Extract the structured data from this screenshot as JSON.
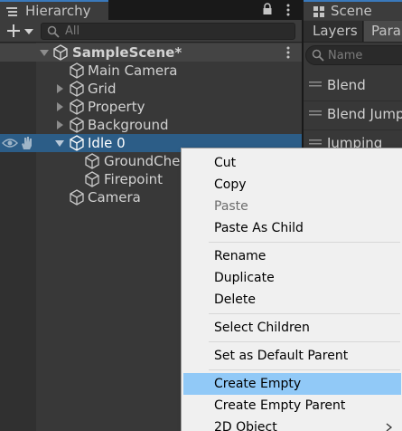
{
  "hierarchy": {
    "tab_label": "Hierarchy",
    "search_placeholder": "All",
    "scene": {
      "label": "SampleScene*"
    },
    "items": [
      {
        "label": "Main Camera"
      },
      {
        "label": "Grid"
      },
      {
        "label": "Property"
      },
      {
        "label": "Background"
      },
      {
        "label": "Idle 0"
      },
      {
        "label": "GroundCheck"
      },
      {
        "label": "Firepoint"
      },
      {
        "label": "Camera"
      }
    ]
  },
  "scene_panel": {
    "tab_label": "Scene",
    "tabs": [
      "Layers",
      "Parameters"
    ],
    "search_placeholder": "Name",
    "parameters": [
      "Blend",
      "Blend Jump",
      "Jumping"
    ]
  },
  "context_menu": {
    "items": [
      {
        "label": "Cut",
        "enabled": true
      },
      {
        "label": "Copy",
        "enabled": true
      },
      {
        "label": "Paste",
        "enabled": false
      },
      {
        "label": "Paste As Child",
        "enabled": true
      },
      {
        "label": "Rename",
        "enabled": true
      },
      {
        "label": "Duplicate",
        "enabled": true
      },
      {
        "label": "Delete",
        "enabled": true
      },
      {
        "label": "Select Children",
        "enabled": true
      },
      {
        "label": "Set as Default Parent",
        "enabled": true
      },
      {
        "label": "Create Empty",
        "enabled": true,
        "highlighted": true
      },
      {
        "label": "Create Empty Parent",
        "enabled": true
      },
      {
        "label": "2D Object",
        "enabled": true,
        "has_submenu": true
      }
    ]
  },
  "colors": {
    "selection": "#2c5d87",
    "menu_highlight": "#91c9f7",
    "tab_accent": "#3a79bb"
  }
}
